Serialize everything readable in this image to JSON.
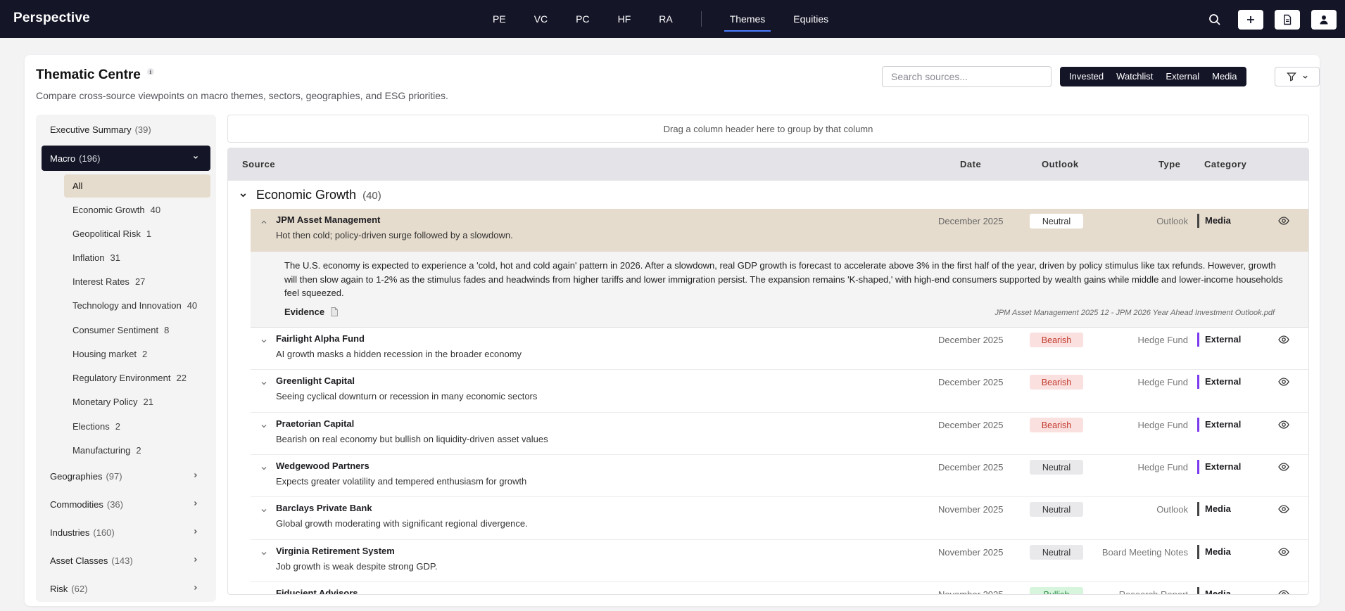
{
  "app": {
    "brand": "Perspective",
    "nav": [
      "PE",
      "VC",
      "PC",
      "HF",
      "RA"
    ],
    "nav2": [
      "Themes",
      "Equities"
    ],
    "active_nav": "Themes"
  },
  "header": {
    "title": "Thematic Centre",
    "info": "i",
    "subtitle": "Compare cross-source viewpoints on macro themes, sectors, geographies, and ESG priorities.",
    "search_placeholder": "Search sources...",
    "segments": [
      "Invested",
      "Watchlist",
      "External",
      "Media"
    ]
  },
  "sidebar": {
    "top": [
      {
        "label": "Executive Summary",
        "count": "(39)"
      }
    ],
    "active": {
      "label": "Macro",
      "count": "(196)"
    },
    "sub": [
      {
        "label": "All",
        "count": ""
      },
      {
        "label": "Economic Growth",
        "count": "40"
      },
      {
        "label": "Geopolitical Risk",
        "count": "1"
      },
      {
        "label": "Inflation",
        "count": "31"
      },
      {
        "label": "Interest Rates",
        "count": "27"
      },
      {
        "label": "Technology and Innovation",
        "count": "40"
      },
      {
        "label": "Consumer Sentiment",
        "count": "8"
      },
      {
        "label": "Housing market",
        "count": "2"
      },
      {
        "label": "Regulatory Environment",
        "count": "22"
      },
      {
        "label": "Monetary Policy",
        "count": "21"
      },
      {
        "label": "Elections",
        "count": "2"
      },
      {
        "label": "Manufacturing",
        "count": "2"
      }
    ],
    "bottom": [
      {
        "label": "Geographies",
        "count": "(97)"
      },
      {
        "label": "Commodities",
        "count": "(36)"
      },
      {
        "label": "Industries",
        "count": "(160)"
      },
      {
        "label": "Asset Classes",
        "count": "(143)"
      },
      {
        "label": "Risk",
        "count": "(62)"
      }
    ]
  },
  "grid": {
    "group_hint": "Drag a column header here to group by that column",
    "columns": {
      "source": "Source",
      "date": "Date",
      "outlook": "Outlook",
      "type": "Type",
      "category": "Category"
    },
    "group": {
      "title": "Economic Growth",
      "count": "(40)"
    },
    "rows": [
      {
        "source": "JPM Asset Management",
        "desc": "Hot then cold; policy-driven surge followed by a slowdown.",
        "date": "December 2025",
        "outlook": "Neutral",
        "type": "Outlook",
        "category": "Media"
      },
      {
        "source": "Fairlight Alpha Fund",
        "desc": "AI growth masks a hidden recession in the broader economy",
        "date": "December 2025",
        "outlook": "Bearish",
        "type": "Hedge Fund",
        "category": "External"
      },
      {
        "source": "Greenlight Capital",
        "desc": "Seeing cyclical downturn or recession in many economic sectors",
        "date": "December 2025",
        "outlook": "Bearish",
        "type": "Hedge Fund",
        "category": "External"
      },
      {
        "source": "Praetorian Capital",
        "desc": "Bearish on real economy but bullish on liquidity-driven asset values",
        "date": "December 2025",
        "outlook": "Bearish",
        "type": "Hedge Fund",
        "category": "External"
      },
      {
        "source": "Wedgewood Partners",
        "desc": "Expects greater volatility and tempered enthusiasm for growth",
        "date": "December 2025",
        "outlook": "Neutral",
        "type": "Hedge Fund",
        "category": "External"
      },
      {
        "source": "Barclays Private Bank",
        "desc": "Global growth moderating with significant regional divergence.",
        "date": "November 2025",
        "outlook": "Neutral",
        "type": "Outlook",
        "category": "Media"
      },
      {
        "source": "Virginia Retirement System",
        "desc": "Job growth is weak despite strong GDP.",
        "date": "November 2025",
        "outlook": "Neutral",
        "type": "Board Meeting Notes",
        "category": "Media"
      },
      {
        "source": "Fiducient Advisors",
        "desc": "",
        "date": "November 2025",
        "outlook": "Bullish",
        "type": "Research Report",
        "category": "Media"
      }
    ],
    "detail": {
      "text": "The U.S. economy is expected to experience a 'cold, hot and cold again' pattern in 2026. After a slowdown, real GDP growth is forecast to accelerate above 3% in the first half of the year, driven by policy stimulus like tax refunds. However, growth will then slow again to 1-2% as the stimulus fades and headwinds from higher tariffs and lower immigration persist. The expansion remains 'K-shaped,' with high-end consumers supported by wealth gains while middle and lower-income households feel squeezed.",
      "evidence_label": "Evidence",
      "evidence_file": "JPM Asset Management 2025 12 - JPM 2026 Year Ahead Investment Outlook.pdf"
    }
  },
  "colors": {
    "nav_bg": "#141628",
    "highlight": "#e6dccd",
    "neutral_bg": "#e9e9ec",
    "bearish_bg": "#fbe0e0",
    "bearish_fg": "#c0392b",
    "bullish_bg": "#d6f5dc",
    "bullish_fg": "#2e8b47",
    "external_bar": "#7c3aed",
    "media_bar": "#444444"
  }
}
